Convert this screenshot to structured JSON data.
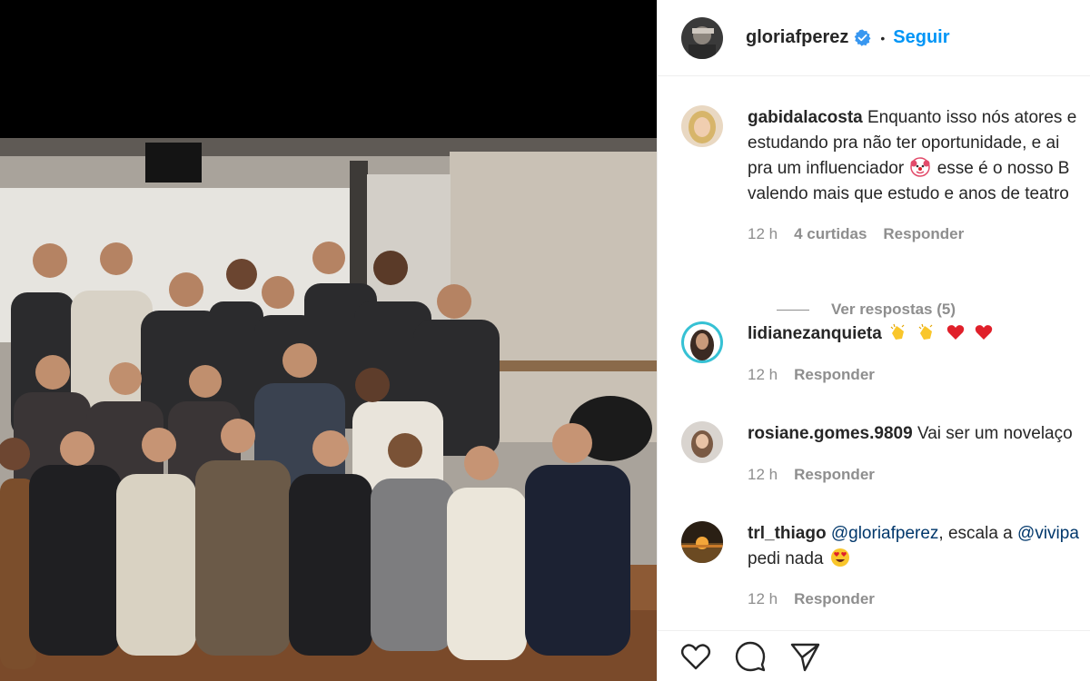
{
  "header": {
    "username": "gloriafperez",
    "separator": "•",
    "follow_label": "Seguir",
    "verified_icon": "verified-badge-icon"
  },
  "comments": [
    {
      "username": "gabidalacosta",
      "lines": [
        "Enquanto isso nós atores e",
        "estudando pra não ter oportunidade, e ai",
        "pra um influenciador",
        "esse é o nosso B",
        "valendo mais que estudo e anos de teatro"
      ],
      "time": "12 h",
      "likes": "4 curtidas",
      "reply_label": "Responder",
      "view_replies": "Ver respostas (5)"
    },
    {
      "username": "lidianezanquieta",
      "text": "",
      "time": "12 h",
      "reply_label": "Responder"
    },
    {
      "username": "rosiane.gomes.9809",
      "text": "Vai ser um novelaço",
      "time": "12 h",
      "reply_label": "Responder"
    },
    {
      "username": "trl_thiago",
      "mention1": "@gloriafperez",
      "text_mid": ", escala a",
      "mention2": "@vivipa",
      "line2": "pedi nada",
      "time": "12 h",
      "reply_label": "Responder"
    }
  ],
  "colors": {
    "link_blue": "#0095f6",
    "mention_blue": "#00376b",
    "meta_gray": "#8e8e8e",
    "text": "#262626"
  },
  "icons": [
    "like-heart-icon",
    "comment-bubble-icon",
    "share-paper-plane-icon",
    "clown-emoji",
    "clapping-hands-emoji",
    "red-heart-emoji",
    "heart-eyes-emoji"
  ]
}
